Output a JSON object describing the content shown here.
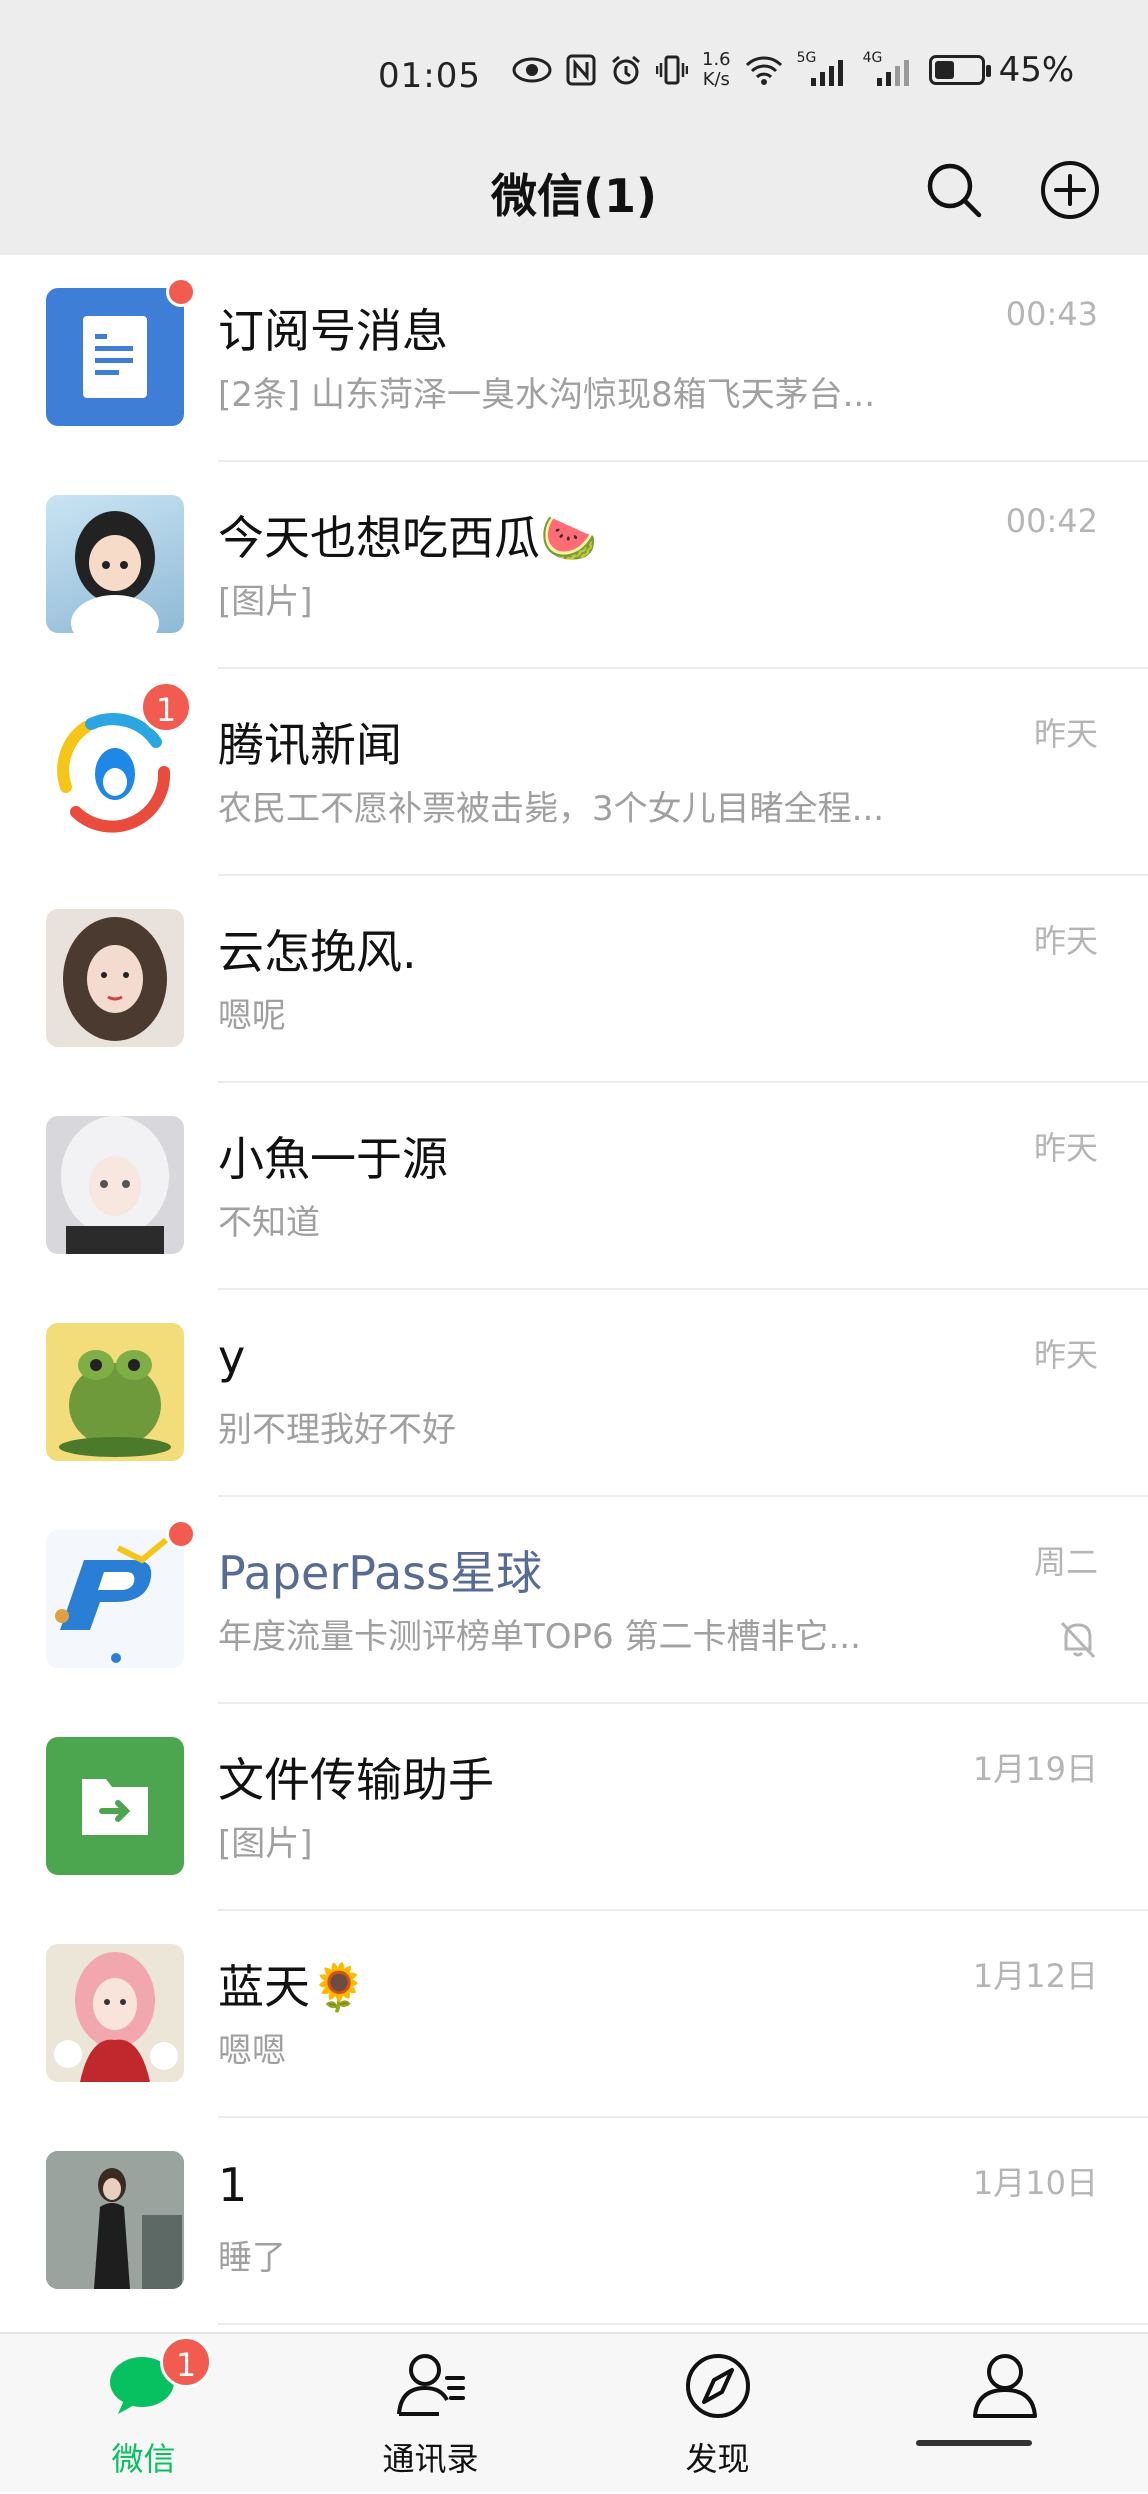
{
  "status_bar": {
    "time": "01:05",
    "net_speed_top": "1.6",
    "net_speed_bottom": "K/s",
    "sig1": "5G",
    "sig2": "4G",
    "battery_level": 0.45,
    "battery_text": "45%"
  },
  "header": {
    "title": "微信(1)",
    "search_icon": "search-icon",
    "add_icon": "add-circle-icon"
  },
  "chats": [
    {
      "name": "订阅号消息",
      "preview": "[2条] 山东菏泽一臭水沟惊现8箱飞天茅台...",
      "time": "00:43"
    },
    {
      "name": "今天也想吃西瓜🍉",
      "preview": "[图片]",
      "time": "00:42"
    },
    {
      "name": "腾讯新闻",
      "preview": "农民工不愿补票被击毙，3个女儿目睹全程...",
      "time": "昨天",
      "badge": "1"
    },
    {
      "name": "云怎挽风.",
      "preview": "嗯呢",
      "time": "昨天"
    },
    {
      "name": "小魚一于源",
      "preview": "不知道",
      "time": "昨天"
    },
    {
      "name": "y",
      "preview": "别不理我好不好",
      "time": "昨天"
    },
    {
      "name": "PaperPass星球",
      "preview": "年度流量卡测评榜单TOP6 第二卡槽非它...",
      "time": "周二"
    },
    {
      "name": "文件传输助手",
      "preview": "[图片]",
      "time": "1月19日"
    },
    {
      "name": "蓝天🌻",
      "preview": "嗯嗯",
      "time": "1月12日"
    },
    {
      "name": "1",
      "preview": "睡了",
      "time": "1月10日"
    }
  ],
  "bottom_nav": {
    "wechat": "微信",
    "wechat_badge": "1",
    "contacts": "通讯录",
    "discover": "发现",
    "me": ""
  },
  "colors": {
    "accent": "#07c160",
    "badge": "#f25b50",
    "header_bg": "#ededed",
    "link_name": "#576b95"
  }
}
